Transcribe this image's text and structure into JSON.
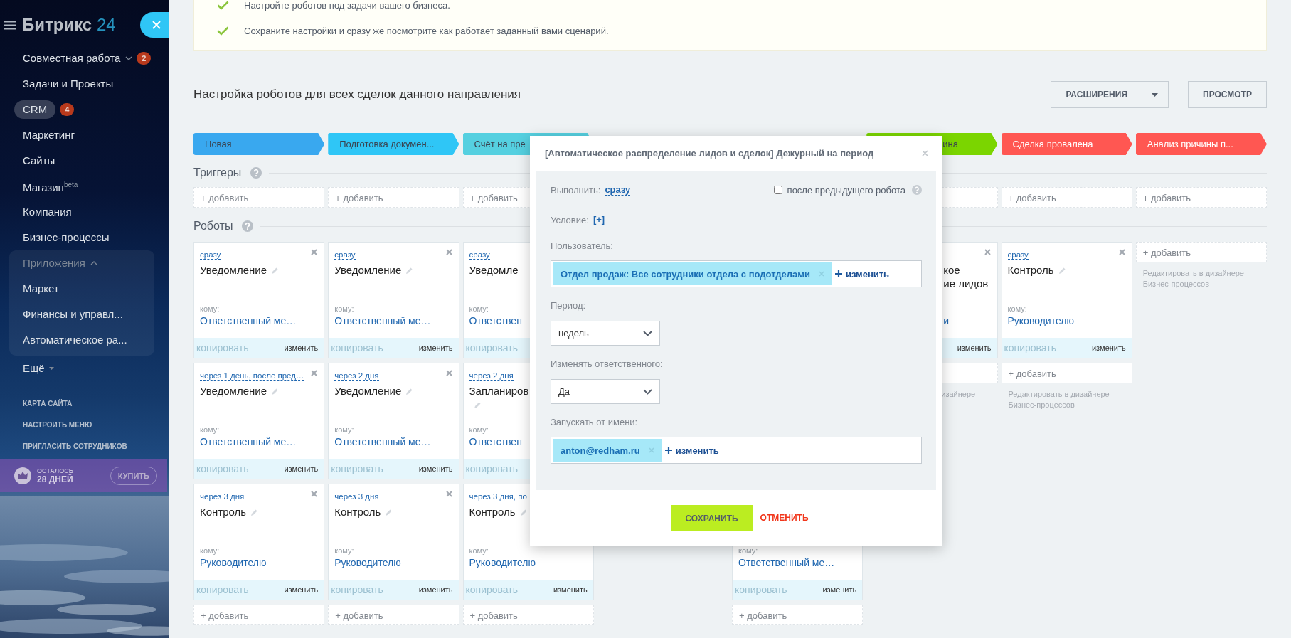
{
  "sidebar": {
    "logo": {
      "text": "Битрикс",
      "number": "24"
    },
    "items": [
      {
        "label": "Совместная работа",
        "counter": "2",
        "selected": false
      },
      {
        "label": "Задачи и Проекты",
        "selected": false
      },
      {
        "label": "CRM",
        "counter": "4",
        "selected": true
      },
      {
        "label": "Маркетинг",
        "selected": false
      },
      {
        "label": "Сайты",
        "selected": false
      },
      {
        "label": "Магазин$^{beta}$",
        "selected": false
      },
      {
        "label": "Компания",
        "selected": false
      },
      {
        "label": "Бизнес-процессы",
        "selected": false
      }
    ],
    "group": {
      "label": "Приложения",
      "expanded": true,
      "items": [
        {
          "label": "Маркет",
          "selected": false
        },
        {
          "label": "Финансы и управл...",
          "selected": false
        },
        {
          "label": "Автоматическое ра...",
          "selected": false
        }
      ]
    },
    "more": "Ещё",
    "links": [
      "КАРТА САЙТА",
      "НАСТРОИТЬ МЕНЮ",
      "ПРИГЛАСИТЬ СОТРУДНИКОВ"
    ],
    "trial": {
      "label": "ОСТАЛОСЬ",
      "days": "28 ДНЕЙ",
      "button": "КУПИТЬ"
    }
  },
  "info": [
    "Настройте роботов под задачи вашего бизнеса.",
    "Сохраните настройки и сразу же посмотрите как работает заданный вами сценарий."
  ],
  "page_title": "Настройка роботов для всех сделок данного направления",
  "toolbar": [
    {
      "label": "РАСШИРЕНИЯ",
      "dropdown": true
    },
    {
      "label": "ПРОСМОТР",
      "dropdown": false
    }
  ],
  "triggers_title": "Триггеры",
  "robots_title": "Роботы",
  "columns": [
    {
      "stage": {
        "kind": "stage",
        "label": "Новая",
        "color": "#39a8ef"
      },
      "trigger": {
        "kind": "add",
        "label": "+ добавить"
      },
      "robots": [
        {
          "kind": "card",
          "delay": "сразу",
          "title": "Уведомление",
          "edit_icon": true,
          "to_label": "кому:",
          "to": "Ответственный ме…",
          "copy": "копировать",
          "edit": "изменить",
          "close": true
        },
        {
          "kind": "card",
          "delay": "через 1 день, после пред…",
          "title": "Уведомление",
          "edit_icon": true,
          "to_label": "кому:",
          "to": "Ответственный ме…",
          "copy": "копировать",
          "edit": "изменить",
          "close": true
        },
        {
          "kind": "card",
          "delay": "через 3 дня",
          "title": "Контроль",
          "edit_icon": true,
          "to_label": "кому:",
          "to": "Руководителю",
          "copy": "копировать",
          "edit": "изменить",
          "close": true
        },
        {
          "kind": "add",
          "label": "+ добавить"
        }
      ]
    },
    {
      "stage": {
        "kind": "stage",
        "label": "Подготовка докумен...",
        "color": "#2fc6f6"
      },
      "trigger": {
        "kind": "add",
        "label": "+ добавить"
      },
      "robots": [
        {
          "kind": "card",
          "delay": "сразу",
          "title": "Уведомление",
          "edit_icon": true,
          "to_label": "кому:",
          "to": "Ответственный ме…",
          "copy": "копировать",
          "edit": "изменить",
          "close": true
        },
        {
          "kind": "card",
          "delay": "через 2 дня",
          "title": "Уведомление",
          "edit_icon": true,
          "to_label": "кому:",
          "to": "Ответственный ме…",
          "copy": "копировать",
          "edit": "изменить",
          "close": true
        },
        {
          "kind": "card",
          "delay": "через 3 дня",
          "title": "Контроль",
          "edit_icon": true,
          "to_label": "кому:",
          "to": "Руководителю",
          "copy": "копировать",
          "edit": "изменить",
          "close": true
        },
        {
          "kind": "add",
          "label": "+ добавить"
        }
      ]
    },
    {
      "stage": {
        "kind": "stage",
        "label": "Счёт на пре",
        "color": "#55d0e0"
      },
      "trigger": {
        "kind": "add",
        "label": "+ добавить"
      },
      "robots": [
        {
          "kind": "card_left",
          "delay": "сразу",
          "title": "Уведомле",
          "edit_icon": false,
          "to_label": "кому:",
          "to": "Ответствен",
          "copy": "копировать"
        },
        {
          "kind": "card_left",
          "delay": "через 2 дня",
          "title": "Запланиров",
          "edit_icon": true,
          "to_label": "кому:",
          "to": "Ответствен",
          "copy": "копировать"
        },
        {
          "kind": "card",
          "delay": "через 3 дня, по",
          "title": "Контроль",
          "edit_icon": true,
          "to_label": "кому:",
          "to": "Руководителю",
          "copy": "копировать",
          "edit": "изменить"
        },
        {
          "kind": "add",
          "label": "+ добавить"
        }
      ]
    },
    {},
    {
      "robots": [
        {
          "kind": "covered"
        },
        {
          "kind": "covered"
        },
        {
          "kind": "card",
          "to_label": "кому:",
          "to": "Ответственный ме…",
          "copy": "копировать",
          "edit": "изменить"
        },
        {
          "kind": "add",
          "label": "+ добавить"
        }
      ]
    },
    {
      "stage": {
        "kind": "stage_right",
        "label": "ина",
        "color": "#7bd500"
      },
      "trigger": {
        "kind": "add"
      },
      "robots": [
        {
          "kind": "card_right",
          "title": "кое\nие лидов",
          "edit_icon": false,
          "to": "и",
          "edit": "изменить",
          "close": true
        },
        {
          "kind": "add"
        },
        {
          "kind": "hint_right",
          "text": "изайнере"
        }
      ]
    },
    {
      "stage": {
        "kind": "stage",
        "label": "Сделка провалена",
        "color": "#ff5752"
      },
      "trigger": {
        "kind": "add",
        "label": "+ добавить"
      },
      "robots": [
        {
          "kind": "card",
          "delay": "сразу",
          "title": "Контроль",
          "edit_icon": true,
          "to_label": "кому:",
          "to": "Руководителю",
          "copy": "копировать",
          "edit": "изменить",
          "close": true
        },
        {
          "kind": "add",
          "label": "+ добавить"
        },
        {
          "kind": "hint",
          "text": "Редактировать в дизайнере Бизнес-процессов"
        }
      ]
    },
    {
      "stage": {
        "kind": "stage",
        "label": "Анализ причины п...",
        "color": "#ff5752"
      },
      "trigger": {
        "kind": "add",
        "label": "+ добавить"
      },
      "robots": [
        {
          "kind": "add",
          "label": "+ добавить"
        },
        {
          "kind": "hint",
          "text": "Редактировать в дизайнере Бизнес-процессов"
        }
      ]
    }
  ],
  "dialog": {
    "title": "[Автоматическое распределение лидов и сделок] Дежурный на период",
    "run": {
      "label": "Выполнить:",
      "value": "сразу"
    },
    "after_previous": {
      "label": "после предыдущего робота",
      "checked": false
    },
    "condition": {
      "label": "Условие:",
      "value": "[+]"
    },
    "fields": [
      {
        "kind": "users",
        "label": "Пользователь:",
        "chips": [
          "Отдел продаж: Все сотрудники отдела с подотделами"
        ],
        "action": "изменить"
      },
      {
        "kind": "select",
        "label": "Период:",
        "value": "недель"
      },
      {
        "kind": "select",
        "label": "Изменять ответственного:",
        "value": "Да"
      },
      {
        "kind": "users",
        "label": "Запускать от имени:",
        "chips": [
          "anton@redham.ru"
        ],
        "action": "изменить"
      }
    ],
    "save": "СОХРАНИТЬ",
    "cancel": "ОТМЕНИТЬ"
  }
}
